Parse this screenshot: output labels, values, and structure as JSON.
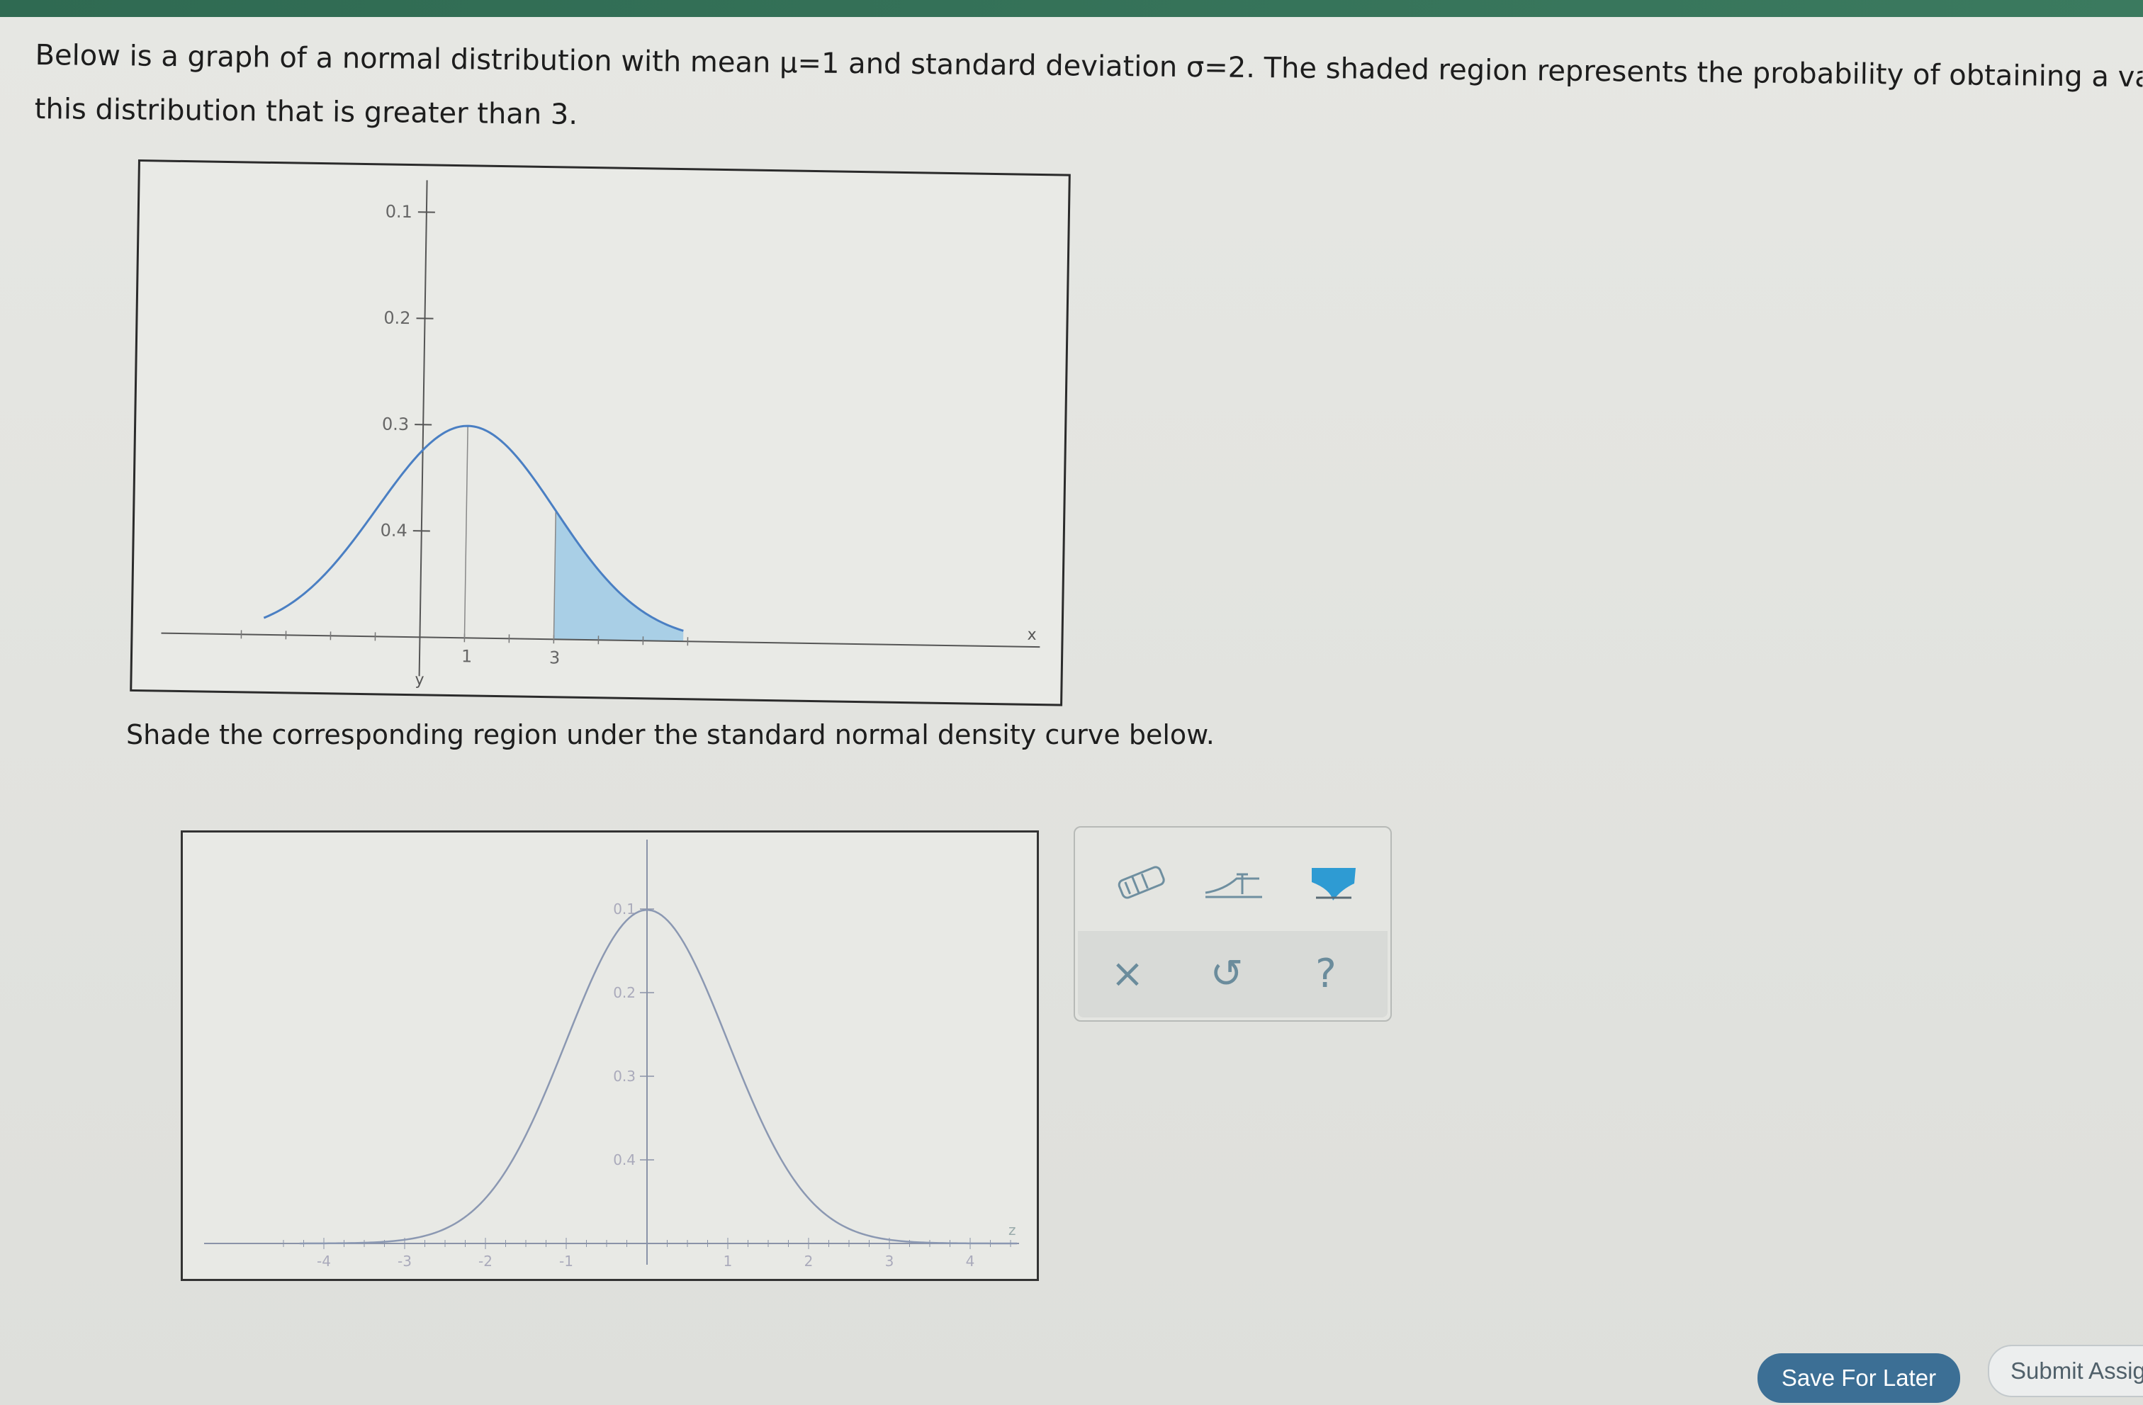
{
  "question": {
    "line1": "Below is a graph of a normal distribution with mean μ=1 and standard deviation σ=2. The shaded region represents the probability of obtaining a va",
    "line2": "this distribution that is greater than 3."
  },
  "graph1": {
    "y_ticks": [
      "0.4",
      "0.3",
      "0.2",
      "0.1"
    ],
    "x_labels": [
      "1",
      "3"
    ],
    "axis_x_label": "x",
    "axis_y_label": "y"
  },
  "instruction": "Shade the corresponding region under the standard normal density curve below.",
  "graph2": {
    "y_ticks": [
      "0.4",
      "0.3",
      "0.2",
      "0.1"
    ],
    "x_labels": [
      "-4",
      "-3",
      "-2",
      "-1",
      "1",
      "2",
      "3",
      "4"
    ],
    "axis_x_label": "z"
  },
  "toolbox": {
    "eraser_icon": "eraser-icon",
    "bound_icon": "boundary-tool-icon",
    "shade_icon": "shade-tool-icon",
    "clear_glyph": "×",
    "undo_glyph": "↺",
    "help_glyph": "?"
  },
  "buttons": {
    "save_label": "Save For Later",
    "submit_label": "Submit Assig"
  },
  "colors": {
    "curve": "#4a7fc3",
    "shade": "#a9cfe6",
    "save_button": "#3c6f95"
  },
  "chart_data": [
    {
      "type": "area",
      "title": "",
      "xlabel": "x",
      "ylabel": "y",
      "ylim": [
        0,
        0.45
      ],
      "y_ticks": [
        0.1,
        0.2,
        0.3,
        0.4
      ],
      "x_marked": [
        1,
        3
      ],
      "distribution": {
        "kind": "normal",
        "mean": 1,
        "sd": 2
      },
      "shaded_region": {
        "from": 3,
        "to": "infinity"
      }
    },
    {
      "type": "line",
      "title": "",
      "xlabel": "z",
      "ylabel": "",
      "ylim": [
        0,
        0.45
      ],
      "xlim": [
        -4,
        4
      ],
      "x_ticks": [
        -4,
        -3,
        -2,
        -1,
        1,
        2,
        3,
        4
      ],
      "y_ticks": [
        0.1,
        0.2,
        0.3,
        0.4
      ],
      "distribution": {
        "kind": "normal",
        "mean": 0,
        "sd": 1
      }
    }
  ]
}
